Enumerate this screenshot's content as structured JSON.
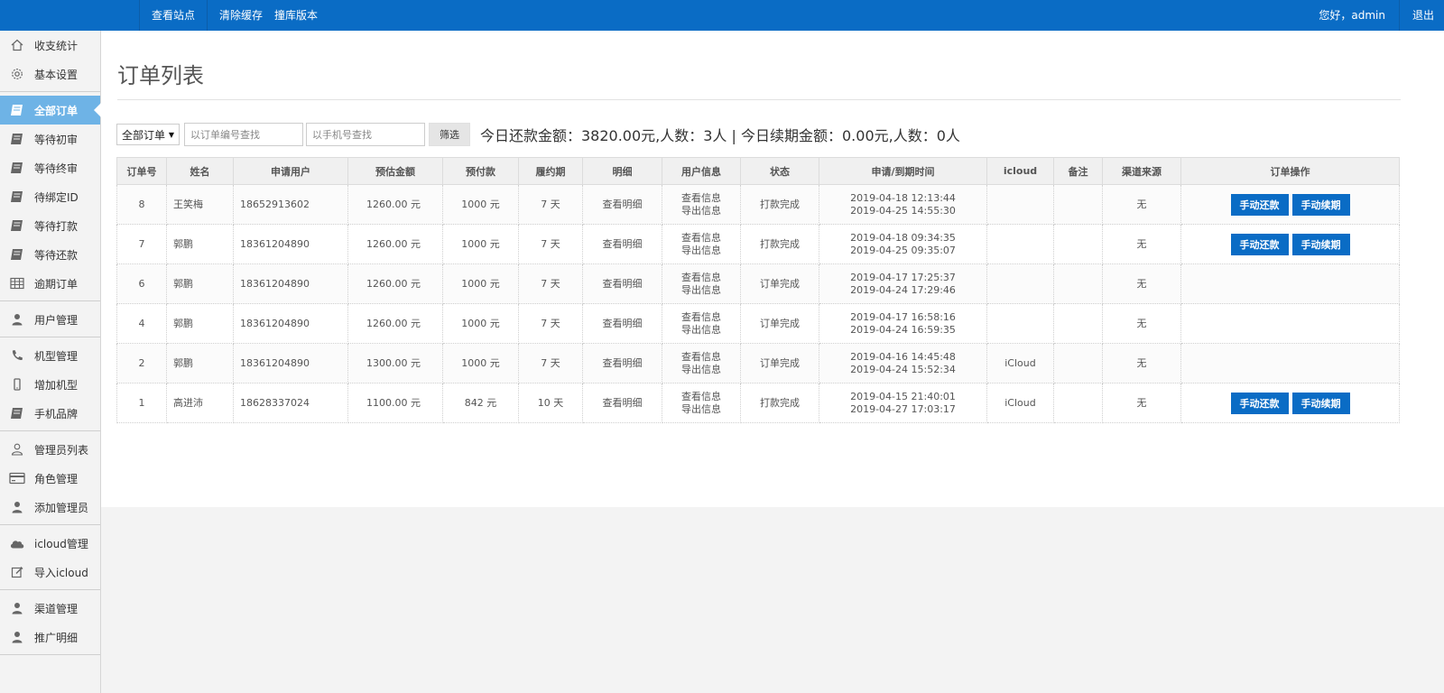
{
  "topbar": {
    "links": [
      "查看站点",
      "清除缓存",
      "撞库版本"
    ],
    "greeting": "您好，admin",
    "logout": "退出"
  },
  "sidebar": {
    "groups": [
      [
        {
          "label": "收支统计",
          "icon": "home-icon"
        },
        {
          "label": "基本设置",
          "icon": "gear-icon"
        }
      ],
      [
        {
          "label": "全部订单",
          "icon": "book-icon",
          "active": true
        },
        {
          "label": "等待初审",
          "icon": "book-icon"
        },
        {
          "label": "等待终审",
          "icon": "book-icon"
        },
        {
          "label": "待绑定ID",
          "icon": "book-icon"
        },
        {
          "label": "等待打款",
          "icon": "book-icon"
        },
        {
          "label": "等待还款",
          "icon": "book-icon"
        },
        {
          "label": "逾期订单",
          "icon": "table-icon"
        }
      ],
      [
        {
          "label": "用户管理",
          "icon": "user-icon"
        }
      ],
      [
        {
          "label": "机型管理",
          "icon": "phone-icon"
        },
        {
          "label": "增加机型",
          "icon": "mobile-icon"
        },
        {
          "label": "手机品牌",
          "icon": "book-icon"
        }
      ],
      [
        {
          "label": "管理员列表",
          "icon": "user-outline-icon"
        },
        {
          "label": "角色管理",
          "icon": "card-icon"
        },
        {
          "label": "添加管理员",
          "icon": "user-icon"
        }
      ],
      [
        {
          "label": "icloud管理",
          "icon": "cloud-icon"
        },
        {
          "label": "导入icloud",
          "icon": "edit-icon"
        }
      ],
      [
        {
          "label": "渠道管理",
          "icon": "user-icon"
        },
        {
          "label": "推广明细",
          "icon": "user-icon"
        }
      ]
    ]
  },
  "main": {
    "title": "订单列表",
    "filter": {
      "select_value": "全部订单",
      "order_placeholder": "以订单编号查找",
      "phone_placeholder": "以手机号查找",
      "button": "筛选"
    },
    "summary": "今日还款金额：3820.00元,人数：3人 | 今日续期金额：0.00元,人数：0人",
    "columns": [
      "订单号",
      "姓名",
      "申请用户",
      "预估金额",
      "预付款",
      "履约期",
      "明细",
      "用户信息",
      "状态",
      "申请/到期时间",
      "icloud",
      "备注",
      "渠道来源",
      "订单操作"
    ],
    "rows": [
      {
        "id": "8",
        "name": "王笑梅",
        "phone": "18652913602",
        "estimate": "1260.00 元",
        "prepay": "1000 元",
        "term": "7 天",
        "detail": "查看明细",
        "info1": "查看信息",
        "info2": "导出信息",
        "status": "打款完成",
        "apply_time": "2019-04-18 12:13:44",
        "due_time": "2019-04-25 14:55:30",
        "icloud": "",
        "note": "",
        "channel": "无",
        "ops": [
          "手动还款",
          "手动续期"
        ]
      },
      {
        "id": "7",
        "name": "郭鹏",
        "phone": "18361204890",
        "estimate": "1260.00 元",
        "prepay": "1000 元",
        "term": "7 天",
        "detail": "查看明细",
        "info1": "查看信息",
        "info2": "导出信息",
        "status": "打款完成",
        "apply_time": "2019-04-18 09:34:35",
        "due_time": "2019-04-25 09:35:07",
        "icloud": "",
        "note": "",
        "channel": "无",
        "ops": [
          "手动还款",
          "手动续期"
        ]
      },
      {
        "id": "6",
        "name": "郭鹏",
        "phone": "18361204890",
        "estimate": "1260.00 元",
        "prepay": "1000 元",
        "term": "7 天",
        "detail": "查看明细",
        "info1": "查看信息",
        "info2": "导出信息",
        "status": "订单完成",
        "apply_time": "2019-04-17 17:25:37",
        "due_time": "2019-04-24 17:29:46",
        "icloud": "",
        "note": "",
        "channel": "无",
        "ops": []
      },
      {
        "id": "4",
        "name": "郭鹏",
        "phone": "18361204890",
        "estimate": "1260.00 元",
        "prepay": "1000 元",
        "term": "7 天",
        "detail": "查看明细",
        "info1": "查看信息",
        "info2": "导出信息",
        "status": "订单完成",
        "apply_time": "2019-04-17 16:58:16",
        "due_time": "2019-04-24 16:59:35",
        "icloud": "",
        "note": "",
        "channel": "无",
        "ops": []
      },
      {
        "id": "2",
        "name": "郭鹏",
        "phone": "18361204890",
        "estimate": "1300.00 元",
        "prepay": "1000 元",
        "term": "7 天",
        "detail": "查看明细",
        "info1": "查看信息",
        "info2": "导出信息",
        "status": "订单完成",
        "apply_time": "2019-04-16 14:45:48",
        "due_time": "2019-04-24 15:52:34",
        "icloud": "iCloud",
        "note": "",
        "channel": "无",
        "ops": []
      },
      {
        "id": "1",
        "name": "高进沛",
        "phone": "18628337024",
        "estimate": "1100.00 元",
        "prepay": "842 元",
        "term": "10 天",
        "detail": "查看明细",
        "info1": "查看信息",
        "info2": "导出信息",
        "status": "打款完成",
        "apply_time": "2019-04-15 21:40:01",
        "due_time": "2019-04-27 17:03:17",
        "icloud": "iCloud",
        "note": "",
        "channel": "无",
        "ops": [
          "手动还款",
          "手动续期"
        ]
      }
    ]
  },
  "colors": {
    "topbar": "#0a6cc5",
    "active_menu": "#6eb3e6",
    "button": "#0a6cc5"
  }
}
